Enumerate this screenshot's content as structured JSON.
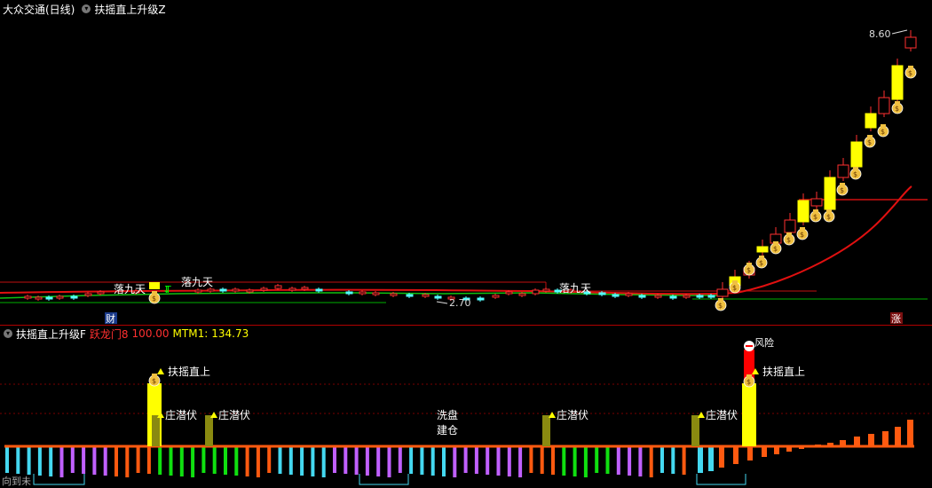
{
  "main": {
    "stock_title": "大众交通(日线)",
    "indicator_name": "扶摇直上升级Z",
    "price_high": "8.60",
    "price_low": "2.70",
    "labels": [
      "落九天",
      "落九天",
      "落九天"
    ],
    "badge_cai": "财",
    "badge_zhang": "涨"
  },
  "sub": {
    "indicator_name": "扶摇直上升级F",
    "param_label": "跃龙门8",
    "param_value": "100.00",
    "mtm_label": "MTM1:",
    "mtm_value": "134.73",
    "signal_fyzs": "扶摇直上",
    "signal_zqf": "庄潜伏",
    "signal_xipan": "洗盘",
    "signal_jiancang": "建仓",
    "signal_top": "风险",
    "bottom_left": "向到未"
  },
  "colors": {
    "bg": "#000000",
    "up": "#ff3030",
    "down": "#54ffff",
    "yellow": "#ffff00",
    "green_line": "#00c000",
    "red_ma": "#e01010",
    "orange": "#ff5a10",
    "cyan": "#44d8f0",
    "purple": "#c060ff",
    "green": "#10e010",
    "olive": "#8a8a10"
  }
}
